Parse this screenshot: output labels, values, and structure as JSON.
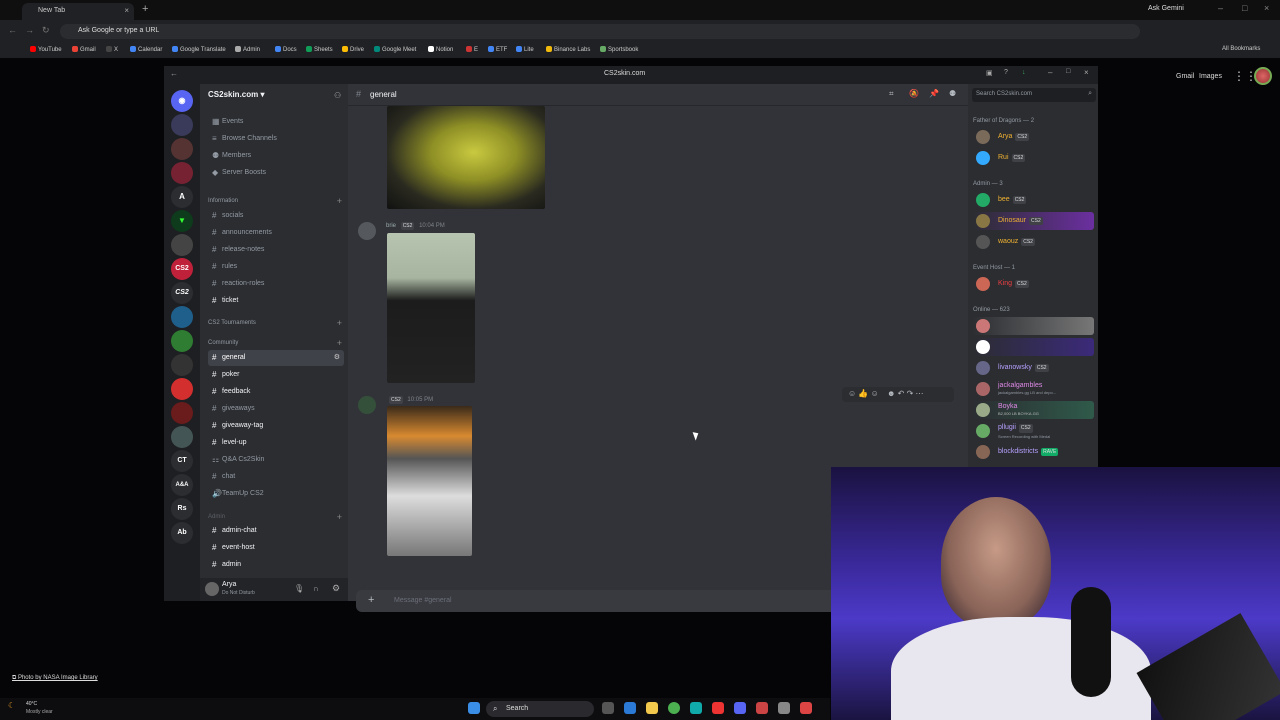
{
  "browser": {
    "tab_title": "New Tab",
    "url_placeholder": "Ask Google or type a URL",
    "gemini": "Ask Gemini",
    "bookmarks": [
      "YouTube",
      "Gmail",
      "X",
      "Calendar",
      "Google Translate",
      "Admin",
      "Docs",
      "Sheets",
      "Drive",
      "Google Meet",
      "Notion",
      "E",
      "ETF",
      "Lite",
      "Binance Labs",
      "Sportsbook"
    ],
    "all_bookmarks": "All Bookmarks",
    "gmail": "Gmail",
    "images": "Images"
  },
  "discord": {
    "window_title": "CS2skin.com",
    "server_name": "CS2skin.com",
    "top_items": [
      "Events",
      "Browse Channels",
      "Members",
      "Server Boosts"
    ],
    "categories": {
      "information": "Information",
      "tournaments": "CS2 Tournaments",
      "community": "Community",
      "admin": "Admin"
    },
    "info_channels": [
      "socials",
      "announcements",
      "release-notes",
      "rules",
      "reaction-roles",
      "ticket"
    ],
    "community_channels": [
      "general",
      "poker",
      "feedback",
      "giveaways",
      "giveaway-tag",
      "level-up",
      "Q&A Cs2Skin",
      "chat",
      "TeamUp CS2"
    ],
    "admin_channels": [
      "admin-chat",
      "event-host",
      "admin"
    ],
    "user": {
      "name": "Arya",
      "status": "Do Not Disturb"
    },
    "chat": {
      "channel": "general",
      "msg1_author": "brie",
      "msg1_tag": "CS2",
      "msg1_time": "10:04 PM",
      "msg2_tag": "CS2",
      "msg2_time": "10:05 PM",
      "placeholder": "Message #general"
    },
    "search_placeholder": "Search CS2skin.com",
    "members": {
      "group1": "Father of Dragons — 2",
      "group2": "Admin — 3",
      "group3": "Event Host — 1",
      "group4": "Online — 623",
      "list1": [
        {
          "name": "Arya",
          "color": "#f0b232"
        },
        {
          "name": "Rui",
          "color": "#f0b232"
        }
      ],
      "list2": [
        {
          "name": "bee",
          "color": "#f0b232"
        },
        {
          "name": "Dinosaur",
          "color": "#f0b232"
        },
        {
          "name": "waouz",
          "color": "#f0b232"
        }
      ],
      "list3": [
        {
          "name": "King",
          "color": "#f23f43"
        }
      ],
      "list4": [
        "livanowsky",
        "jackalgambles",
        "Boyka",
        "pllugii",
        "blockdistricts"
      ],
      "sub4": [
        "jackalgambles.gg LB and depo...",
        "B2,000 LB BOYKA.GG",
        "Screen Recording with Medal"
      ],
      "badge": "CS2",
      "rave": "RAVE"
    }
  },
  "photo_credit": "Photo by NASA Image Library",
  "weather": {
    "temp": "40°C",
    "cond": "Mostly clear"
  },
  "taskbar_search": "Search"
}
